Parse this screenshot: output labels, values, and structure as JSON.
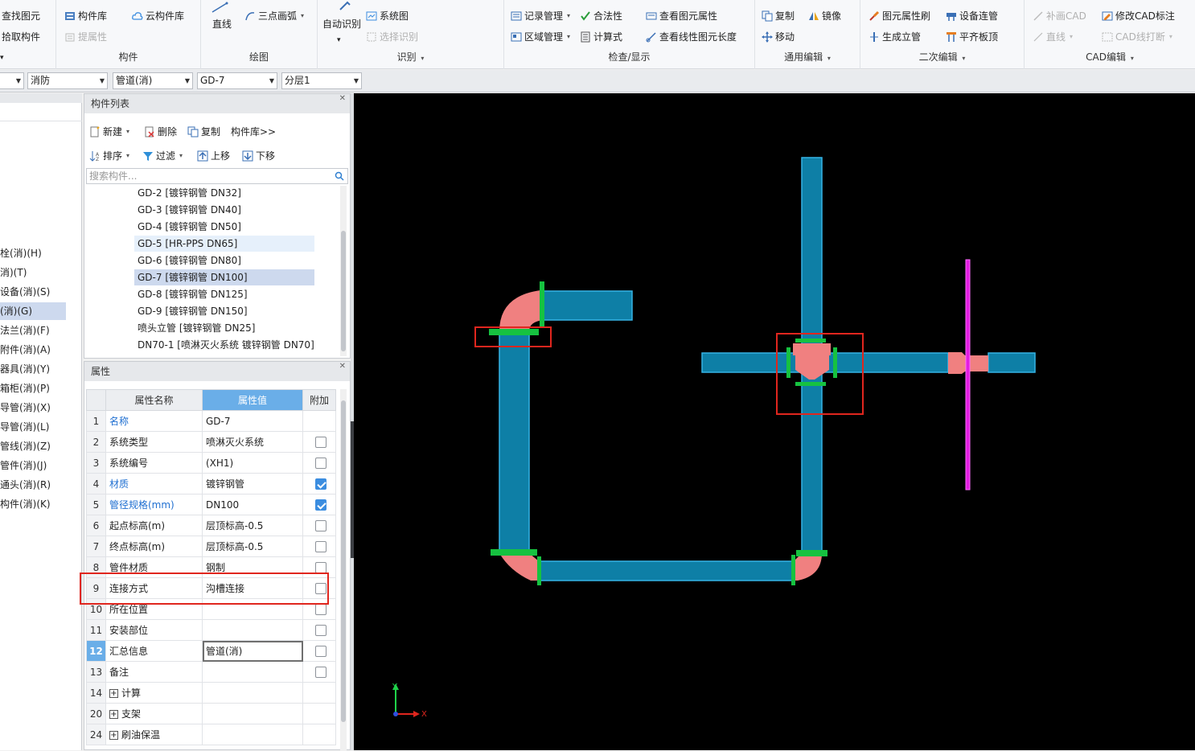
{
  "ribbon": {
    "col0": {
      "find": "查找图元",
      "pick": "拾取构件"
    },
    "component": {
      "title": "构件",
      "lib": "构件库",
      "cloud": "云构件库",
      "extract": "提属性"
    },
    "draw": {
      "title": "绘图",
      "line": "直线",
      "arc": "三点画弧"
    },
    "recognize": {
      "title": "识别",
      "auto": "自动识别",
      "system_diagram": "系统图",
      "select_recognize": "选择识别"
    },
    "check": {
      "title": "检查/显示",
      "record": "记录管理",
      "legality": "合法性",
      "view_props": "查看图元属性",
      "region": "区域管理",
      "formula": "计算式",
      "view_length": "查看线性图元长度"
    },
    "edit": {
      "title": "通用编辑",
      "copy": "复制",
      "mirror": "镜像",
      "move": "移动"
    },
    "secondary": {
      "title": "二次编辑",
      "brush": "图元属性刷",
      "connect": "设备连管",
      "riser": "生成立管",
      "flush": "平齐板顶"
    },
    "cad": {
      "title": "CAD编辑",
      "patch": "补画CAD",
      "modify": "修改CAD标注",
      "line": "直线",
      "break": "CAD线打断"
    }
  },
  "filters": {
    "discipline": "消防",
    "type": "管道(消)",
    "component": "GD-7",
    "layer": "分层1"
  },
  "tree": {
    "items": [
      "栓(消)(H)",
      "消)(T)",
      "设备(消)(S)",
      "(消)(G)",
      "法兰(消)(F)",
      "附件(消)(A)",
      "器具(消)(Y)",
      "箱柜(消)(P)",
      "导管(消)(X)",
      "导管(消)(L)",
      "管线(消)(Z)",
      "管件(消)(J)",
      "通头(消)(R)",
      "构件(消)(K)"
    ],
    "selected_index": 3
  },
  "complist": {
    "title": "构件列表",
    "toolbar": {
      "new": "新建",
      "delete": "删除",
      "copy": "复制",
      "lib": "构件库>>",
      "sort": "排序",
      "filter": "过滤",
      "up": "上移",
      "down": "下移"
    },
    "search_placeholder": "搜索构件...",
    "items": [
      "GD-2 [镀锌钢管 DN32]",
      "GD-3 [镀锌钢管 DN40]",
      "GD-4 [镀锌钢管 DN50]",
      "GD-5 [HR-PPS DN65]",
      "GD-6 [镀锌钢管 DN80]",
      "GD-7 [镀锌钢管 DN100]",
      "GD-8 [镀锌钢管 DN125]",
      "GD-9 [镀锌钢管 DN150]",
      "喷头立管 [镀锌钢管 DN25]",
      "DN70-1 [喷淋灭火系统 镀锌钢管 DN70]"
    ],
    "hover_index": 3,
    "selected_index": 5
  },
  "props": {
    "title": "属性",
    "headers": {
      "name": "属性名称",
      "value": "属性值",
      "extra": "附加"
    },
    "rows": [
      {
        "num": "1",
        "name": "名称",
        "value": "GD-7",
        "blue": true,
        "cb": null
      },
      {
        "num": "2",
        "name": "系统类型",
        "value": "喷淋灭火系统",
        "blue": false,
        "cb": false
      },
      {
        "num": "3",
        "name": "系统编号",
        "value": "(XH1)",
        "blue": false,
        "cb": false
      },
      {
        "num": "4",
        "name": "材质",
        "value": "镀锌钢管",
        "blue": true,
        "cb": true
      },
      {
        "num": "5",
        "name": "管径规格(mm)",
        "value": "DN100",
        "blue": true,
        "cb": true
      },
      {
        "num": "6",
        "name": "起点标高(m)",
        "value": "层顶标高-0.5",
        "blue": false,
        "cb": false
      },
      {
        "num": "7",
        "name": "终点标高(m)",
        "value": "层顶标高-0.5",
        "blue": false,
        "cb": false
      },
      {
        "num": "8",
        "name": "管件材质",
        "value": "钢制",
        "blue": false,
        "cb": false
      },
      {
        "num": "9",
        "name": "连接方式",
        "value": "沟槽连接",
        "blue": false,
        "cb": false
      },
      {
        "num": "10",
        "name": "所在位置",
        "value": "",
        "blue": false,
        "cb": false
      },
      {
        "num": "11",
        "name": "安装部位",
        "value": "",
        "blue": false,
        "cb": false
      },
      {
        "num": "12",
        "name": "汇总信息",
        "value": "管道(消)",
        "blue": false,
        "cb": false,
        "current": true
      },
      {
        "num": "13",
        "name": "备注",
        "value": "",
        "blue": false,
        "cb": false
      },
      {
        "num": "14",
        "name": "计算",
        "value": "",
        "blue": false,
        "cb": null,
        "group": true
      },
      {
        "num": "20",
        "name": "支架",
        "value": "",
        "blue": false,
        "cb": null,
        "group": true
      },
      {
        "num": "24",
        "name": "刷油保温",
        "value": "",
        "blue": false,
        "cb": null,
        "group": true
      }
    ]
  },
  "canvas": {
    "axis_x": "X",
    "axis_y": "Y",
    "colors": {
      "pipe": "#0e7fa6",
      "pipe_edge": "#35b4e6",
      "fitting": "#f08080",
      "joint": "#16c240",
      "riser": "#e11ce0",
      "highlight": "#e0261e"
    }
  }
}
